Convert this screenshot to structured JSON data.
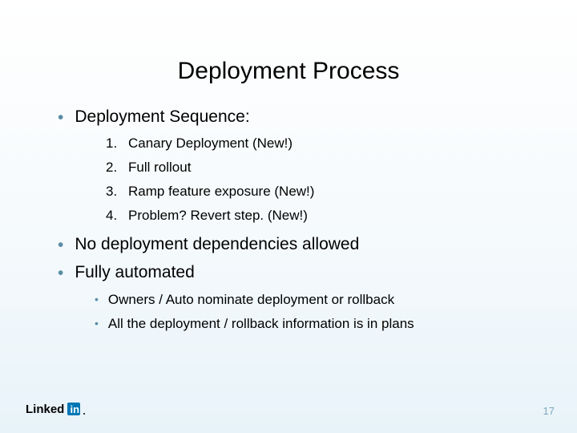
{
  "slide": {
    "title": "Deployment Process",
    "bullets": [
      {
        "text": "Deployment Sequence:",
        "numbered": [
          {
            "n": "1.",
            "text": "Canary Deployment (New!)"
          },
          {
            "n": "2.",
            "text": "Full rollout"
          },
          {
            "n": "3.",
            "text": "Ramp feature exposure (New!)"
          },
          {
            "n": "4.",
            "text": "Problem? Revert step. (New!)"
          }
        ]
      },
      {
        "text": "No deployment dependencies allowed"
      },
      {
        "text": "Fully automated",
        "sub": [
          "Owners / Auto nominate deployment or rollback",
          "All the deployment / rollback information is in plans"
        ]
      }
    ],
    "page_number": "17",
    "logo_name": "linkedin-logo"
  },
  "colors": {
    "bullet_accent": "#5b8ca5",
    "page_num": "#7fa9bd",
    "logo_blue": "#0077b5"
  }
}
